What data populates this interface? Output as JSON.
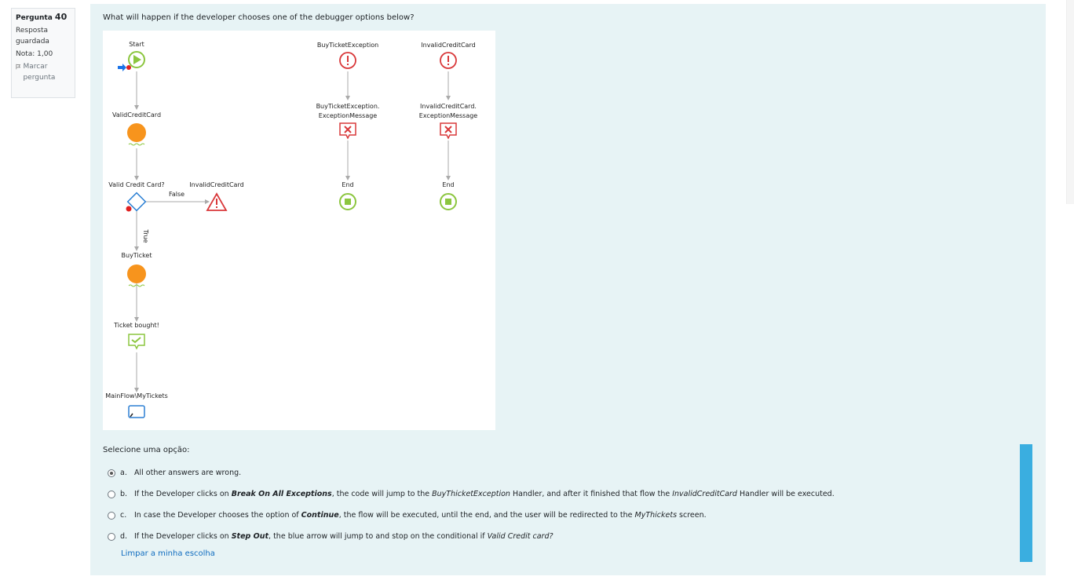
{
  "question_info": {
    "question_label": "Pergunta",
    "question_number": "40",
    "status": "Resposta guardada",
    "grade": "Nota: 1,00",
    "flag_label": "Marcar pergunta"
  },
  "question": {
    "text": "What will happen if the developer chooses one of the debugger options below?",
    "prompt": "Selecione uma opção:",
    "clear_label": "Limpar a minha escolha"
  },
  "diagram": {
    "start": "Start",
    "valid_credit_card": "ValidCreditCard",
    "if_label": "Valid Credit Card?",
    "false_label": "False",
    "true_label": "True",
    "invalid_credit_card_raise": "InvalidCreditCard",
    "buy_ticket": "BuyTicket",
    "ticket_bought": "Ticket bought!",
    "destination": "MainFlow\\MyTickets",
    "handler1_title": "BuyTicketException",
    "handler1_msg_line1": "BuyTicketException.",
    "handler1_msg_line2": "ExceptionMessage",
    "handler1_end": "End",
    "handler2_title": "InvalidCreditCard",
    "handler2_msg_line1": "InvalidCreditCard.",
    "handler2_msg_line2": "ExceptionMessage",
    "handler2_end": "End"
  },
  "options": [
    {
      "letter": "a.",
      "selected": true,
      "t1": "All other answers are wrong."
    },
    {
      "letter": "b.",
      "selected": false,
      "t1": "If the Developer clicks on ",
      "b1": "Break On All Exceptions",
      "t2": ", the code will jump to the ",
      "i1": "BuyThicketException",
      "t3": " Handler, and after it finished that flow the ",
      "i2": "InvalidCreditCard",
      "t4": " Handler will be executed."
    },
    {
      "letter": "c.",
      "selected": false,
      "t1": "In case the Developer chooses the option of ",
      "b1": "Continue",
      "t2": ", the flow will be executed, until the end, and the user will be redirected to the ",
      "i1": "MyThickets",
      "t3": " screen."
    },
    {
      "letter": "d.",
      "selected": false,
      "t1": "If the Developer clicks on ",
      "b1": "Step Out",
      "t2": ", the blue arrow will jump to and stop on the conditional if ",
      "i1": "Valid Credit card?"
    }
  ],
  "colors": {
    "panel_bg": "#e7f3f5",
    "link": "#0f6cbf",
    "scroll_accent": "#3aaee0"
  }
}
